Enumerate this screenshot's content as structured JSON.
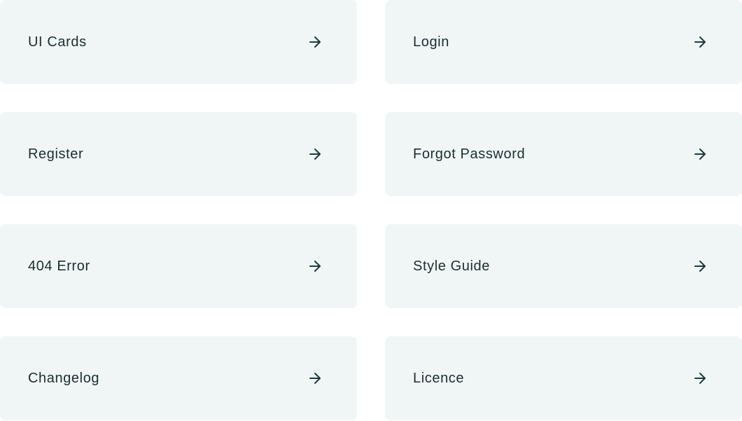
{
  "cards": [
    {
      "label": "UI Cards",
      "icon": "arrow-right-icon"
    },
    {
      "label": "Login",
      "icon": "arrow-right-icon"
    },
    {
      "label": "Register",
      "icon": "arrow-right-icon"
    },
    {
      "label": "Forgot Password",
      "icon": "arrow-right-icon"
    },
    {
      "label": "404 Error",
      "icon": "arrow-right-icon"
    },
    {
      "label": "Style Guide",
      "icon": "arrow-right-icon"
    },
    {
      "label": "Changelog",
      "icon": "arrow-right-icon"
    },
    {
      "label": "Licence",
      "icon": "arrow-right-icon"
    }
  ],
  "colors": {
    "card_background": "#f0f6f6",
    "text": "#1f2d2d",
    "icon": "#1f3a3a"
  }
}
